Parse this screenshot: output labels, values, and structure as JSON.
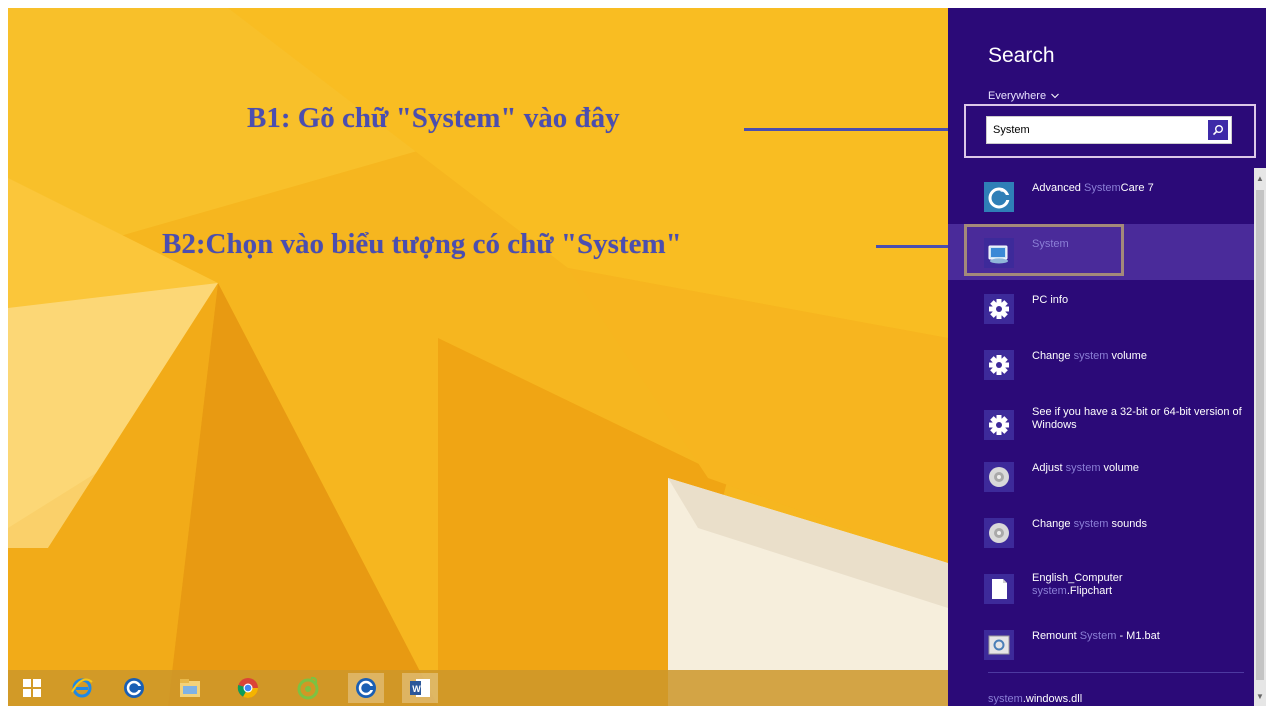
{
  "annotations": {
    "step1": "B1: Gõ chữ \"System\" vào đây",
    "step2": "B2:Chọn vào biểu tượng có chữ \"System\""
  },
  "search_pane": {
    "title": "Search",
    "scope": "Everywhere",
    "query": "System"
  },
  "results": [
    {
      "icon": "advanced-systemcare-icon",
      "parts": [
        "Advanced ",
        "SystemCare 7"
      ],
      "hl": [
        false,
        false
      ],
      "hl_word": "System"
    },
    {
      "icon": "system-icon",
      "label": "System",
      "selected": true
    },
    {
      "icon": "gear-icon",
      "label": "PC info"
    },
    {
      "icon": "gear-icon",
      "pre": "Change ",
      "hl": "system",
      "post": " volume"
    },
    {
      "icon": "gear-icon",
      "label": "See if you have a 32-bit or 64-bit version of Windows"
    },
    {
      "icon": "speaker-icon",
      "pre": "Adjust ",
      "hl": "system",
      "post": " volume"
    },
    {
      "icon": "speaker-icon",
      "pre": "Change ",
      "hl": "system",
      "post": " sounds"
    },
    {
      "icon": "document-icon",
      "line1": "English_Computer",
      "line2_hl": "system",
      "line2_post": ".Flipchart"
    },
    {
      "icon": "batch-file-icon",
      "pre": "Remount ",
      "hl": "System",
      "post": " - M1.bat"
    }
  ],
  "result_text": {
    "r0_pre": "Advanced ",
    "r0_hl": "System",
    "r0_post": "Care 7",
    "r1_hl": "System",
    "r2_label": "PC info",
    "r3_pre": "Change ",
    "r3_hl": "system",
    "r3_post": " volume",
    "r4_label": "See if you have a 32-bit or 64-bit version of Windows",
    "r5_pre": "Adjust ",
    "r5_hl": "system",
    "r5_post": " volume",
    "r6_pre": "Change ",
    "r6_hl": "system",
    "r6_post": " sounds",
    "r7_line1": "English_Computer",
    "r7_hl": "system",
    "r7_post": ".Flipchart",
    "r8_pre": "Remount ",
    "r8_hl": "System",
    "r8_post": " - M1.bat"
  },
  "footer": {
    "hl": "system",
    "post": ".windows.dll"
  },
  "taskbar": {
    "items": [
      "start-icon",
      "internet-explorer-icon",
      "advanced-systemcare-icon",
      "file-explorer-icon",
      "chrome-icon",
      "coccoc-icon",
      "advanced-systemcare-icon",
      "word-icon"
    ]
  },
  "colors": {
    "search_pane_bg": "#2b0a78",
    "wallpaper_base": "#f5b41e",
    "annotation": "#4b4eb0",
    "highlight_text": "#8b7fd6"
  }
}
